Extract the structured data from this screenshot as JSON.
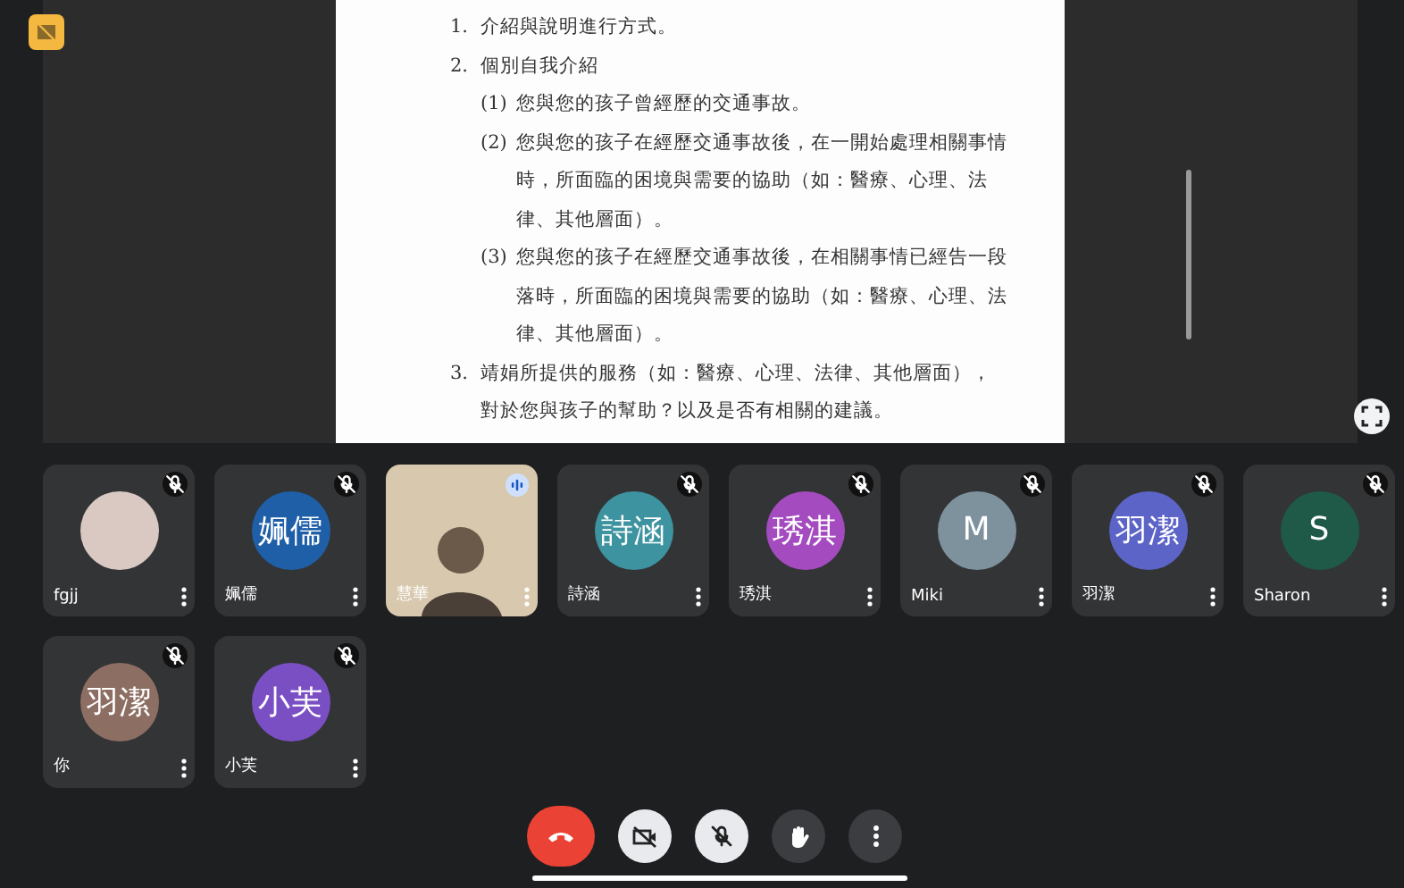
{
  "document": {
    "items": [
      {
        "number": "1.",
        "text": "介紹與說明進行方式。"
      },
      {
        "number": "2.",
        "text": "個別自我介紹",
        "children": [
          {
            "number": "(1)",
            "text": "您與您的孩子曾經歷的交通事故。"
          },
          {
            "number": "(2)",
            "text": "您與您的孩子在經歷交通事故後，在一開始處理相關事情時，所面臨的困境與需要的協助（如：醫療、心理、法律、其他層面）。"
          },
          {
            "number": "(3)",
            "text": "您與您的孩子在經歷交通事故後，在相關事情已經告一段落時，所面臨的困境與需要的協助（如：醫療、心理、法律、其他層面）。"
          }
        ]
      },
      {
        "number": "3.",
        "text": "靖娟所提供的服務（如：醫療、心理、法律、其他層面），對於您與孩子的幫助？以及是否有相關的建議。"
      }
    ]
  },
  "participants": [
    {
      "kind": "photo",
      "name": "fgjj",
      "muted": true
    },
    {
      "kind": "initials",
      "initials": "姵儒",
      "name": "姵儒",
      "color": "#1f5fa8",
      "muted": true
    },
    {
      "kind": "video",
      "name": "慧華",
      "muted": false
    },
    {
      "kind": "initials",
      "initials": "詩涵",
      "name": "詩涵",
      "color": "#3d93a0",
      "muted": true
    },
    {
      "kind": "initials",
      "initials": "琇淇",
      "name": "琇淇",
      "color": "#a44bbf",
      "muted": true
    },
    {
      "kind": "initials",
      "initials": "M",
      "name": "Miki",
      "color": "#7e929e",
      "muted": true
    },
    {
      "kind": "initials",
      "initials": "羽潔",
      "name": "羽潔",
      "color": "#5c64c8",
      "muted": true
    },
    {
      "kind": "initials",
      "initials": "S",
      "name": "Sharon",
      "color": "#1f5a48",
      "muted": true
    },
    {
      "kind": "initials",
      "initials": "羽潔",
      "name": "你",
      "color": "#8d6e63",
      "muted": true
    },
    {
      "kind": "initials",
      "initials": "小芙",
      "name": "小芙",
      "color": "#7a4fc4",
      "muted": true
    }
  ],
  "controls": [
    {
      "kind": "end-call"
    },
    {
      "kind": "camera",
      "off": true
    },
    {
      "kind": "mic",
      "off": true
    },
    {
      "kind": "hand"
    },
    {
      "kind": "more"
    }
  ]
}
